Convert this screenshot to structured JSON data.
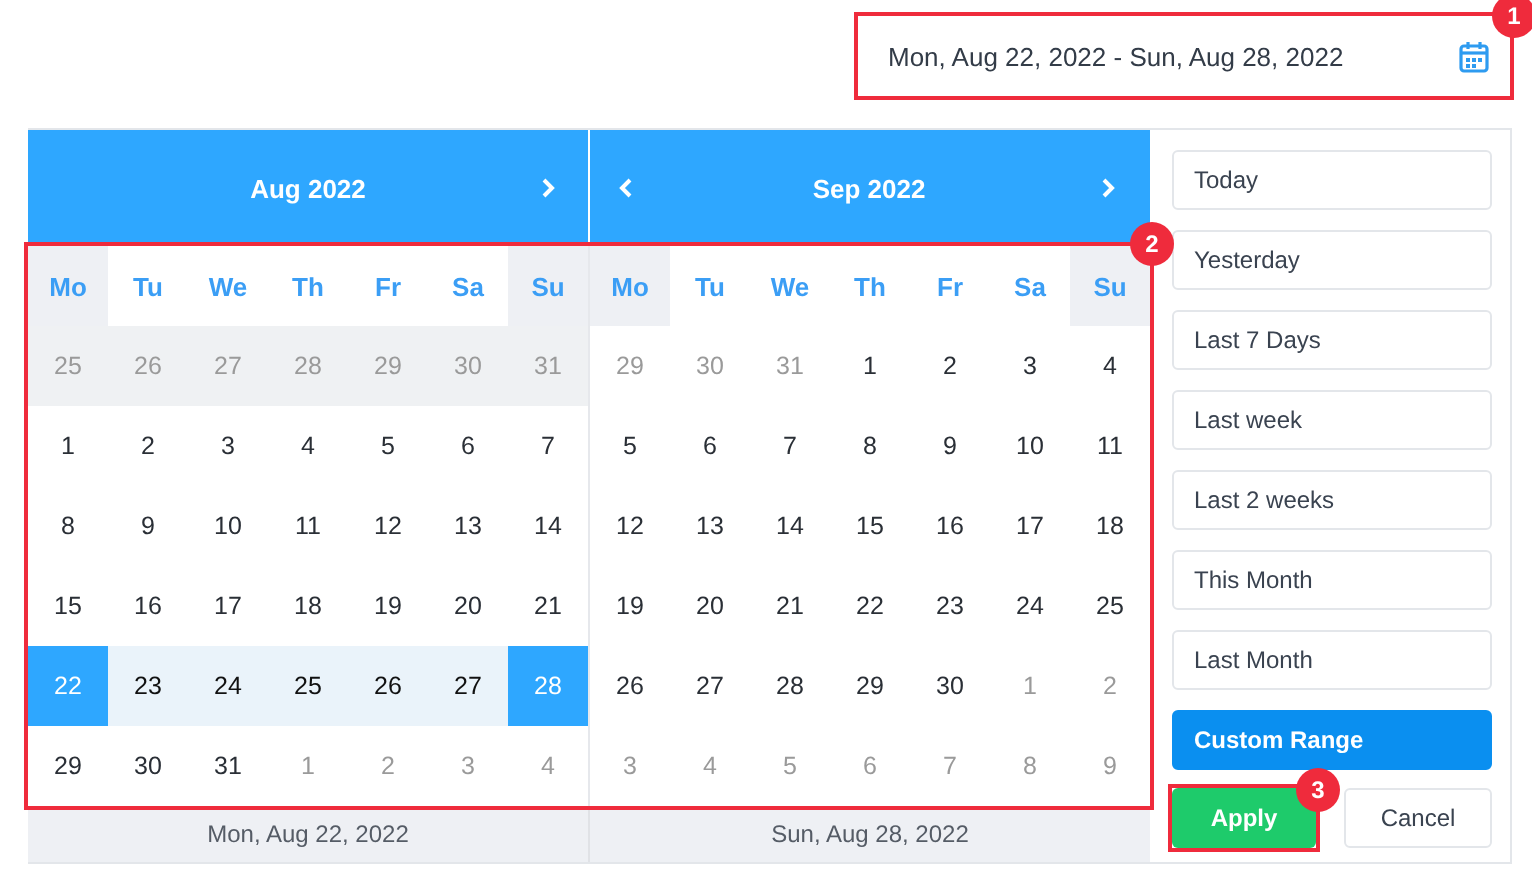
{
  "date_field": {
    "value": "Mon, Aug 22, 2022 - Sun, Aug 28, 2022",
    "annotation": "1"
  },
  "calendar_annotation": "2",
  "months": [
    {
      "title": "Aug 2022",
      "prev": false,
      "next": true,
      "footer": "Mon, Aug 22, 2022",
      "weekdays": [
        {
          "label": "Mo",
          "shaded": true
        },
        {
          "label": "Tu",
          "shaded": false
        },
        {
          "label": "We",
          "shaded": false
        },
        {
          "label": "Th",
          "shaded": false
        },
        {
          "label": "Fr",
          "shaded": false
        },
        {
          "label": "Sa",
          "shaded": false
        },
        {
          "label": "Su",
          "shaded": true
        }
      ],
      "weeks": [
        {
          "shaded": true,
          "days": [
            {
              "label": "25",
              "muted": true,
              "selected": false,
              "in_range": false
            },
            {
              "label": "26",
              "muted": true,
              "selected": false,
              "in_range": false
            },
            {
              "label": "27",
              "muted": true,
              "selected": false,
              "in_range": false
            },
            {
              "label": "28",
              "muted": true,
              "selected": false,
              "in_range": false
            },
            {
              "label": "29",
              "muted": true,
              "selected": false,
              "in_range": false
            },
            {
              "label": "30",
              "muted": true,
              "selected": false,
              "in_range": false
            },
            {
              "label": "31",
              "muted": true,
              "selected": false,
              "in_range": false
            }
          ]
        },
        {
          "shaded": false,
          "days": [
            {
              "label": "1",
              "muted": false,
              "selected": false,
              "in_range": false
            },
            {
              "label": "2",
              "muted": false,
              "selected": false,
              "in_range": false
            },
            {
              "label": "3",
              "muted": false,
              "selected": false,
              "in_range": false
            },
            {
              "label": "4",
              "muted": false,
              "selected": false,
              "in_range": false
            },
            {
              "label": "5",
              "muted": false,
              "selected": false,
              "in_range": false
            },
            {
              "label": "6",
              "muted": false,
              "selected": false,
              "in_range": false
            },
            {
              "label": "7",
              "muted": false,
              "selected": false,
              "in_range": false
            }
          ]
        },
        {
          "shaded": false,
          "days": [
            {
              "label": "8",
              "muted": false,
              "selected": false,
              "in_range": false
            },
            {
              "label": "9",
              "muted": false,
              "selected": false,
              "in_range": false
            },
            {
              "label": "10",
              "muted": false,
              "selected": false,
              "in_range": false
            },
            {
              "label": "11",
              "muted": false,
              "selected": false,
              "in_range": false
            },
            {
              "label": "12",
              "muted": false,
              "selected": false,
              "in_range": false
            },
            {
              "label": "13",
              "muted": false,
              "selected": false,
              "in_range": false
            },
            {
              "label": "14",
              "muted": false,
              "selected": false,
              "in_range": false
            }
          ]
        },
        {
          "shaded": false,
          "days": [
            {
              "label": "15",
              "muted": false,
              "selected": false,
              "in_range": false
            },
            {
              "label": "16",
              "muted": false,
              "selected": false,
              "in_range": false
            },
            {
              "label": "17",
              "muted": false,
              "selected": false,
              "in_range": false
            },
            {
              "label": "18",
              "muted": false,
              "selected": false,
              "in_range": false
            },
            {
              "label": "19",
              "muted": false,
              "selected": false,
              "in_range": false
            },
            {
              "label": "20",
              "muted": false,
              "selected": false,
              "in_range": false
            },
            {
              "label": "21",
              "muted": false,
              "selected": false,
              "in_range": false
            }
          ]
        },
        {
          "shaded": false,
          "days": [
            {
              "label": "22",
              "muted": false,
              "selected": true,
              "in_range": true
            },
            {
              "label": "23",
              "muted": false,
              "selected": false,
              "in_range": true
            },
            {
              "label": "24",
              "muted": false,
              "selected": false,
              "in_range": true
            },
            {
              "label": "25",
              "muted": false,
              "selected": false,
              "in_range": true
            },
            {
              "label": "26",
              "muted": false,
              "selected": false,
              "in_range": true
            },
            {
              "label": "27",
              "muted": false,
              "selected": false,
              "in_range": true
            },
            {
              "label": "28",
              "muted": false,
              "selected": true,
              "in_range": true
            }
          ]
        },
        {
          "shaded": false,
          "days": [
            {
              "label": "29",
              "muted": false,
              "selected": false,
              "in_range": false
            },
            {
              "label": "30",
              "muted": false,
              "selected": false,
              "in_range": false
            },
            {
              "label": "31",
              "muted": false,
              "selected": false,
              "in_range": false
            },
            {
              "label": "1",
              "muted": true,
              "selected": false,
              "in_range": false
            },
            {
              "label": "2",
              "muted": true,
              "selected": false,
              "in_range": false
            },
            {
              "label": "3",
              "muted": true,
              "selected": false,
              "in_range": false
            },
            {
              "label": "4",
              "muted": true,
              "selected": false,
              "in_range": false
            }
          ]
        }
      ]
    },
    {
      "title": "Sep 2022",
      "prev": true,
      "next": true,
      "footer": "Sun, Aug 28, 2022",
      "weekdays": [
        {
          "label": "Mo",
          "shaded": true
        },
        {
          "label": "Tu",
          "shaded": false
        },
        {
          "label": "We",
          "shaded": false
        },
        {
          "label": "Th",
          "shaded": false
        },
        {
          "label": "Fr",
          "shaded": false
        },
        {
          "label": "Sa",
          "shaded": false
        },
        {
          "label": "Su",
          "shaded": true
        }
      ],
      "weeks": [
        {
          "shaded": false,
          "days": [
            {
              "label": "29",
              "muted": true,
              "selected": false,
              "in_range": false
            },
            {
              "label": "30",
              "muted": true,
              "selected": false,
              "in_range": false
            },
            {
              "label": "31",
              "muted": true,
              "selected": false,
              "in_range": false
            },
            {
              "label": "1",
              "muted": false,
              "selected": false,
              "in_range": false
            },
            {
              "label": "2",
              "muted": false,
              "selected": false,
              "in_range": false
            },
            {
              "label": "3",
              "muted": false,
              "selected": false,
              "in_range": false
            },
            {
              "label": "4",
              "muted": false,
              "selected": false,
              "in_range": false
            }
          ]
        },
        {
          "shaded": false,
          "days": [
            {
              "label": "5",
              "muted": false,
              "selected": false,
              "in_range": false
            },
            {
              "label": "6",
              "muted": false,
              "selected": false,
              "in_range": false
            },
            {
              "label": "7",
              "muted": false,
              "selected": false,
              "in_range": false
            },
            {
              "label": "8",
              "muted": false,
              "selected": false,
              "in_range": false
            },
            {
              "label": "9",
              "muted": false,
              "selected": false,
              "in_range": false
            },
            {
              "label": "10",
              "muted": false,
              "selected": false,
              "in_range": false
            },
            {
              "label": "11",
              "muted": false,
              "selected": false,
              "in_range": false
            }
          ]
        },
        {
          "shaded": false,
          "days": [
            {
              "label": "12",
              "muted": false,
              "selected": false,
              "in_range": false
            },
            {
              "label": "13",
              "muted": false,
              "selected": false,
              "in_range": false
            },
            {
              "label": "14",
              "muted": false,
              "selected": false,
              "in_range": false
            },
            {
              "label": "15",
              "muted": false,
              "selected": false,
              "in_range": false
            },
            {
              "label": "16",
              "muted": false,
              "selected": false,
              "in_range": false
            },
            {
              "label": "17",
              "muted": false,
              "selected": false,
              "in_range": false
            },
            {
              "label": "18",
              "muted": false,
              "selected": false,
              "in_range": false
            }
          ]
        },
        {
          "shaded": false,
          "days": [
            {
              "label": "19",
              "muted": false,
              "selected": false,
              "in_range": false
            },
            {
              "label": "20",
              "muted": false,
              "selected": false,
              "in_range": false
            },
            {
              "label": "21",
              "muted": false,
              "selected": false,
              "in_range": false
            },
            {
              "label": "22",
              "muted": false,
              "selected": false,
              "in_range": false
            },
            {
              "label": "23",
              "muted": false,
              "selected": false,
              "in_range": false
            },
            {
              "label": "24",
              "muted": false,
              "selected": false,
              "in_range": false
            },
            {
              "label": "25",
              "muted": false,
              "selected": false,
              "in_range": false
            }
          ]
        },
        {
          "shaded": false,
          "days": [
            {
              "label": "26",
              "muted": false,
              "selected": false,
              "in_range": false
            },
            {
              "label": "27",
              "muted": false,
              "selected": false,
              "in_range": false
            },
            {
              "label": "28",
              "muted": false,
              "selected": false,
              "in_range": false
            },
            {
              "label": "29",
              "muted": false,
              "selected": false,
              "in_range": false
            },
            {
              "label": "30",
              "muted": false,
              "selected": false,
              "in_range": false
            },
            {
              "label": "1",
              "muted": true,
              "selected": false,
              "in_range": false
            },
            {
              "label": "2",
              "muted": true,
              "selected": false,
              "in_range": false
            }
          ]
        },
        {
          "shaded": false,
          "days": [
            {
              "label": "3",
              "muted": true,
              "selected": false,
              "in_range": false
            },
            {
              "label": "4",
              "muted": true,
              "selected": false,
              "in_range": false
            },
            {
              "label": "5",
              "muted": true,
              "selected": false,
              "in_range": false
            },
            {
              "label": "6",
              "muted": true,
              "selected": false,
              "in_range": false
            },
            {
              "label": "7",
              "muted": true,
              "selected": false,
              "in_range": false
            },
            {
              "label": "8",
              "muted": true,
              "selected": false,
              "in_range": false
            },
            {
              "label": "9",
              "muted": true,
              "selected": false,
              "in_range": false
            }
          ]
        }
      ]
    }
  ],
  "ranges": [
    {
      "label": "Today",
      "selected": false
    },
    {
      "label": "Yesterday",
      "selected": false
    },
    {
      "label": "Last 7 Days",
      "selected": false
    },
    {
      "label": "Last week",
      "selected": false
    },
    {
      "label": "Last 2 weeks",
      "selected": false
    },
    {
      "label": "This Month",
      "selected": false
    },
    {
      "label": "Last Month",
      "selected": false
    },
    {
      "label": "Custom Range",
      "selected": true
    }
  ],
  "buttons": [
    {
      "label": "Apply",
      "kind": "apply",
      "annotation": "3"
    },
    {
      "label": "Cancel",
      "kind": "cancel"
    }
  ]
}
